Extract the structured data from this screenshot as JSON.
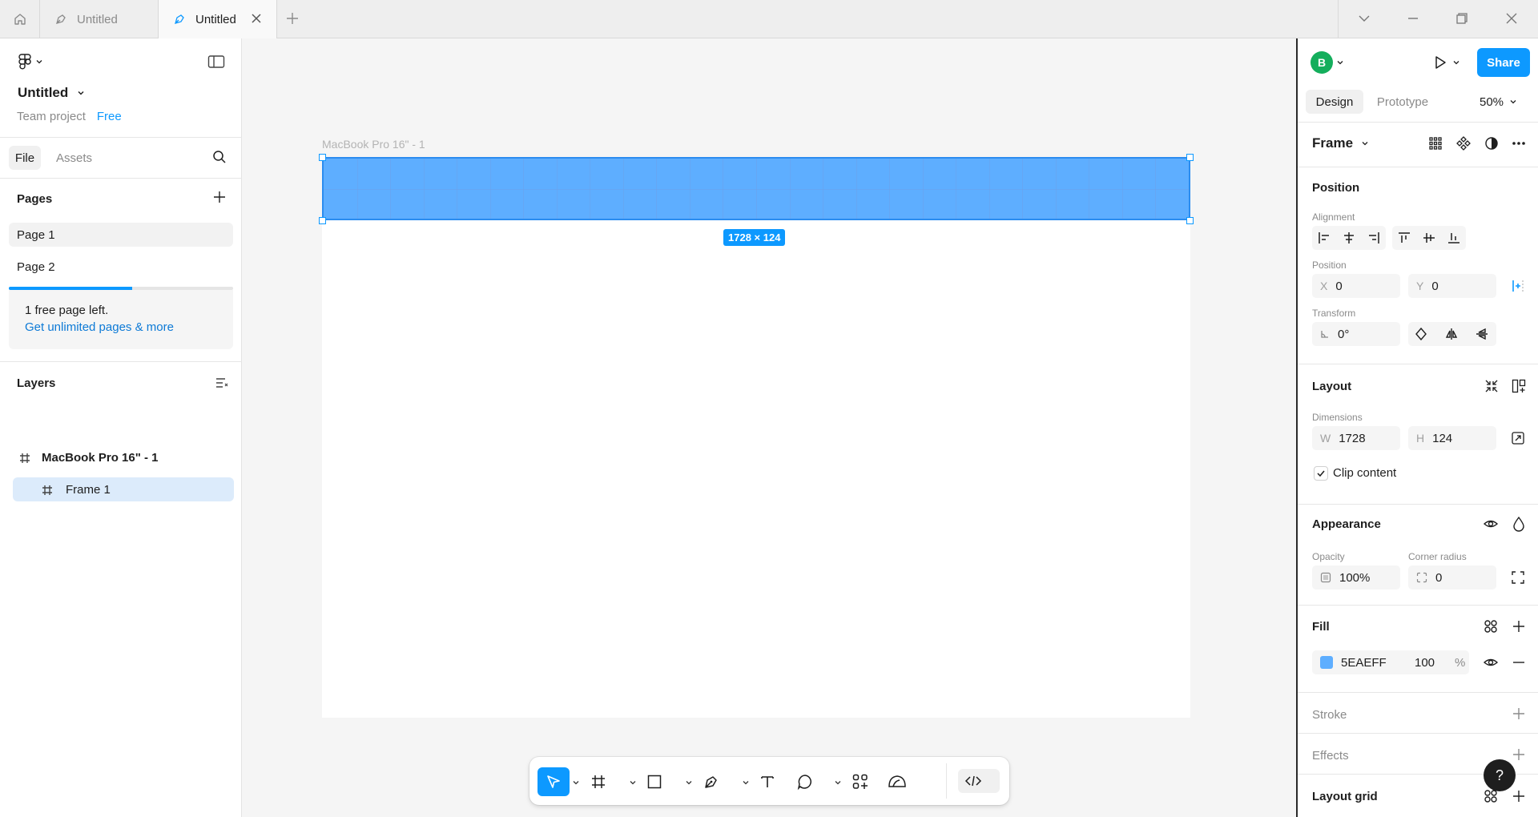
{
  "titlebar": {
    "tabs": [
      {
        "label": "Untitled"
      },
      {
        "label": "Untitled"
      }
    ]
  },
  "left": {
    "file_title": "Untitled",
    "team": "Team project",
    "plan": "Free",
    "tabs": {
      "file": "File",
      "assets": "Assets"
    },
    "pages_title": "Pages",
    "pages": [
      {
        "label": "Page 1"
      },
      {
        "label": "Page 2"
      }
    ],
    "page_limit_progress": 0.55,
    "upsell_text": "1 free page left.",
    "upsell_link": "Get unlimited pages & more",
    "layers_title": "Layers",
    "layers": [
      {
        "label": "MacBook Pro 16\" - 1"
      },
      {
        "label": "Frame 1"
      }
    ]
  },
  "canvas": {
    "frame_label": "MacBook Pro 16\" - 1",
    "selection_size": "1728 × 124",
    "frame_fill": "#ffffff",
    "selection_fill": "#5EAEFF"
  },
  "right": {
    "avatar_initial": "B",
    "share_label": "Share",
    "tab_design": "Design",
    "tab_prototype": "Prototype",
    "zoom": "50%",
    "selection_type": "Frame",
    "position_title": "Position",
    "alignment_label": "Alignment",
    "position_label": "Position",
    "x_prefix": "X",
    "x_value": "0",
    "y_prefix": "Y",
    "y_value": "0",
    "transform_label": "Transform",
    "rotation_value": "0°",
    "layout_title": "Layout",
    "dimensions_label": "Dimensions",
    "w_prefix": "W",
    "w_value": "1728",
    "h_prefix": "H",
    "h_value": "124",
    "clip_content": "Clip content",
    "appearance_title": "Appearance",
    "opacity_label": "Opacity",
    "opacity_value": "100%",
    "radius_label": "Corner radius",
    "radius_value": "0",
    "fill_title": "Fill",
    "fill_hex": "5EAEFF",
    "fill_opacity": "100",
    "fill_pct": "%",
    "stroke_title": "Stroke",
    "effects_title": "Effects",
    "layout_grid_title": "Layout grid",
    "help": "?"
  },
  "colors": {
    "accent": "#0d99ff",
    "selection": "#5EAEFF",
    "avatar": "#14ae5c"
  }
}
